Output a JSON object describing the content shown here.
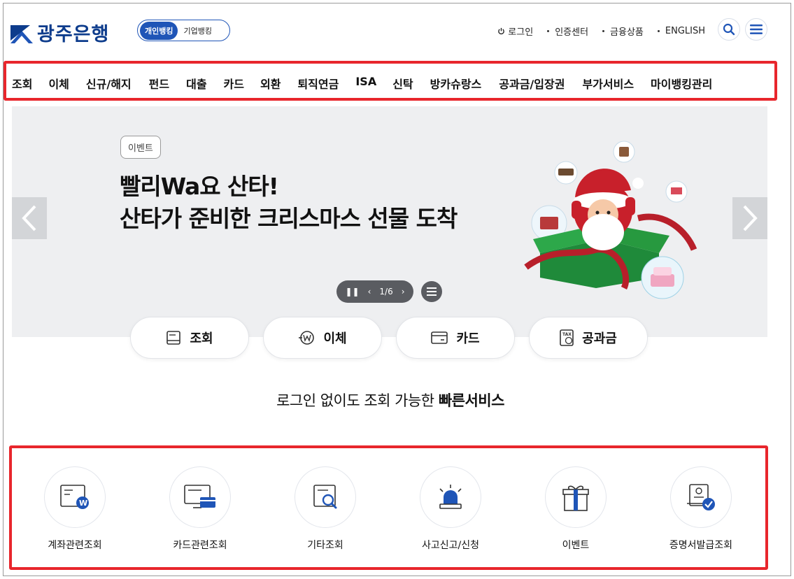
{
  "header": {
    "logo_text": "광주은행",
    "toggle": {
      "personal": "개인뱅킹",
      "corporate": "기업뱅킹"
    },
    "util": {
      "login": "로그인",
      "cert": "인증센터",
      "products": "금융상품",
      "english": "ENGLISH"
    }
  },
  "gnb": [
    "조회",
    "이체",
    "신규/해지",
    "펀드",
    "대출",
    "카드",
    "외환",
    "퇴직연금",
    "ISA",
    "신탁",
    "방카슈랑스",
    "공과금/입장권",
    "부가서비스",
    "마이뱅킹관리"
  ],
  "banner": {
    "tag": "이벤트",
    "line1": "빨리Wa요 산타!",
    "line2": "산타가 준비한 크리스마스 선물 도착",
    "pager": "1/6"
  },
  "quick_pills": [
    "조회",
    "이체",
    "카드",
    "공과금"
  ],
  "quick_title": {
    "normal": "로그인 없이도 조회 가능한 ",
    "bold": "빠른서비스"
  },
  "services": [
    "계좌관련조회",
    "카드관련조회",
    "기타조회",
    "사고신고/신청",
    "이벤트",
    "증명서발급조회"
  ],
  "colors": {
    "brand": "#0d3c8c",
    "accent": "#1f55b7",
    "highlight": "#e8262c"
  }
}
